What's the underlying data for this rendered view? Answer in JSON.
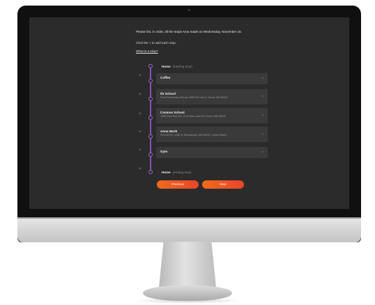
{
  "question": {
    "prompt": "Please list, in order, all the stops Ama made on Wednesday, November 15.",
    "hint": "Click the + to add each stop.",
    "help_link": "What is a stop?"
  },
  "timeline": {
    "start": {
      "label": "Home",
      "sublabel": "(starting stop)"
    },
    "end": {
      "label": "Home",
      "sublabel": "(ending stop)"
    },
    "stops": [
      {
        "name": "Coffee",
        "address": ""
      },
      {
        "name": "Ifa School",
        "address": "Fiore Elementary School, 5000 Elm Ave E, Dundi, MN 55412"
      },
      {
        "name": "Cosmos School",
        "address": "1488 Park Blvd Ste, 2100 Sam Lake Rd, Dundi, MN 55426"
      },
      {
        "name": "Anna Work",
        "address": "Red Hill Co, 1400 N, Minneapolis, MN 55405, United States"
      },
      {
        "name": "Gym",
        "address": ""
      }
    ],
    "add_symbol": "+",
    "remove_symbol": "×"
  },
  "buttons": {
    "previous": "Previous",
    "next": "Next"
  },
  "colors": {
    "accent_orange": "#f06a1c",
    "timeline_purple": "#8a4fb8",
    "screen_bg": "#2b2b2b"
  }
}
